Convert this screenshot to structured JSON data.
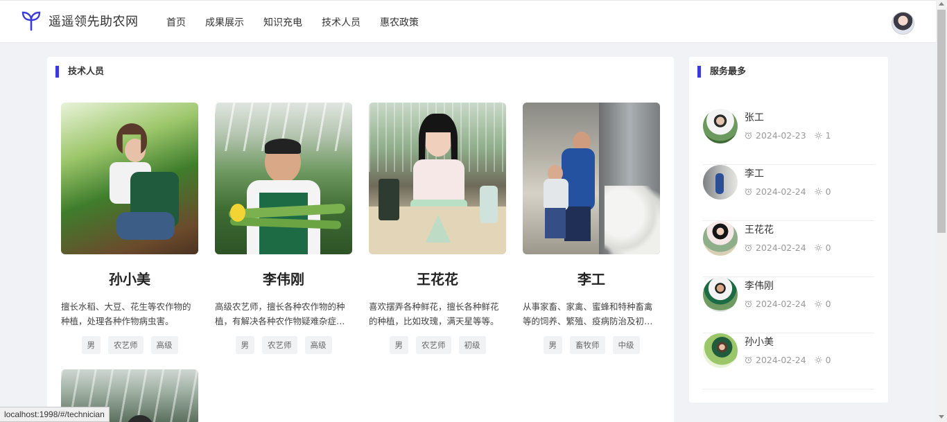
{
  "header": {
    "site_name": "遥遥领先助农网",
    "nav": [
      "首页",
      "成果展示",
      "知识充电",
      "技术人员",
      "惠农政策"
    ]
  },
  "main": {
    "title": "技术人员",
    "technicians": [
      {
        "name": "孙小美",
        "desc": "擅长水稻、大豆、花生等农作物的种植，处理各种作物病虫害。",
        "tags": [
          "男",
          "农艺师",
          "高级"
        ]
      },
      {
        "name": "李伟刚",
        "desc": "高级农艺师，擅长各种农作物的种植，有解决各种农作物疑难杂症的能力。",
        "tags": [
          "男",
          "农艺师",
          "高级"
        ]
      },
      {
        "name": "王花花",
        "desc": "喜欢摆弄各种鲜花，擅长各种鲜花的种植，比如玫瑰，满天星等等。",
        "tags": [
          "男",
          "农艺师",
          "初级"
        ]
      },
      {
        "name": "李工",
        "desc": "从事家畜、家禽、蜜蜂和特种畜禽等的饲养、繁殖、疫病防治及初级加工。",
        "tags": [
          "男",
          "畜牧师",
          "中级"
        ]
      }
    ]
  },
  "side": {
    "title": "服务最多",
    "items": [
      {
        "name": "张工",
        "date": "2024-02-23",
        "count": "1"
      },
      {
        "name": "李工",
        "date": "2024-02-24",
        "count": "0"
      },
      {
        "name": "王花花",
        "date": "2024-02-24",
        "count": "0"
      },
      {
        "name": "李伟刚",
        "date": "2024-02-24",
        "count": "0"
      },
      {
        "name": "孙小美",
        "date": "2024-02-24",
        "count": "0"
      }
    ]
  },
  "status_bar": {
    "url": "localhost:1998/#/technician"
  },
  "colors": {
    "accent": "#3b3bdb",
    "page_bg": "#f0f2f5"
  },
  "icons": {
    "logo": "sprout-icon",
    "date": "alarm-clock-icon",
    "count": "sun-icon"
  }
}
